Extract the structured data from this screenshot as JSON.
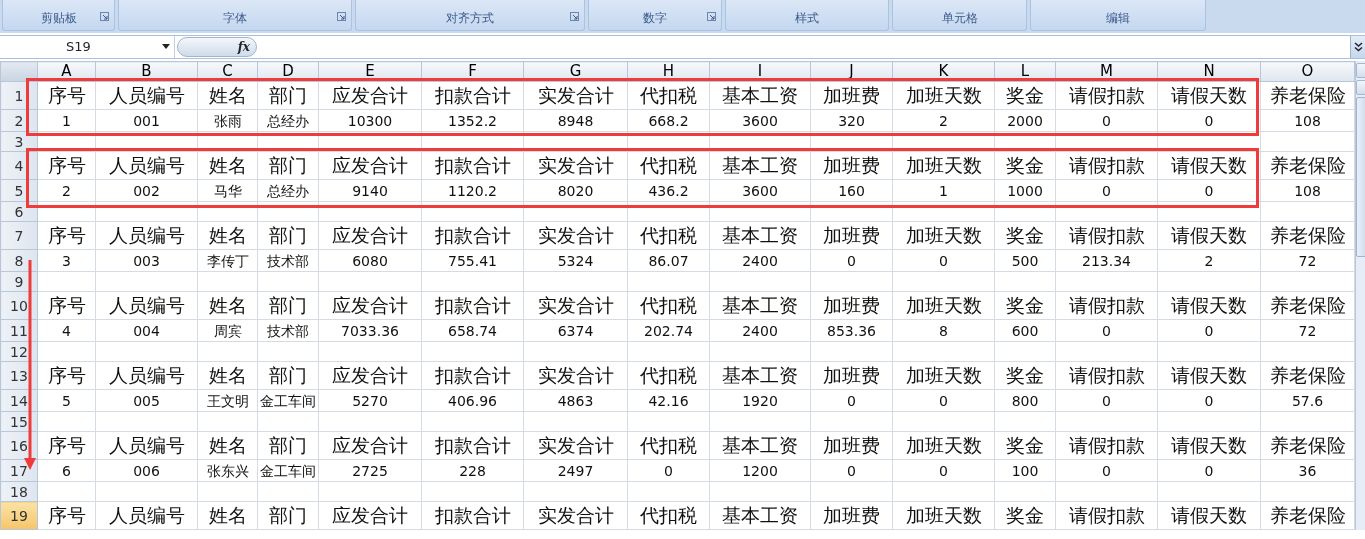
{
  "ribbon": {
    "groups": [
      {
        "label": "剪贴板",
        "has_launcher": true
      },
      {
        "label": "字体",
        "has_launcher": true
      },
      {
        "label": "对齐方式",
        "has_launcher": true
      },
      {
        "label": "数字",
        "has_launcher": true
      },
      {
        "label": "样式",
        "has_launcher": false
      },
      {
        "label": "单元格",
        "has_launcher": false
      },
      {
        "label": "编辑",
        "has_launcher": false
      }
    ]
  },
  "formula_bar": {
    "name_box": "S19",
    "fx": "fx"
  },
  "columns": [
    "A",
    "B",
    "C",
    "D",
    "E",
    "F",
    "G",
    "H",
    "I",
    "J",
    "K",
    "L",
    "M",
    "N",
    "O"
  ],
  "rows": [
    {
      "number": "1",
      "kind": "header",
      "selected": false,
      "cells": [
        "序号",
        "人员编号",
        "姓名",
        "部门",
        "应发合计",
        "扣款合计",
        "实发合计",
        "代扣税",
        "基本工资",
        "加班费",
        "加班天数",
        "奖金",
        "请假扣款",
        "请假天数",
        "养老保险"
      ]
    },
    {
      "number": "2",
      "kind": "data",
      "selected": false,
      "cells": [
        "1",
        "001",
        "张雨",
        "总经办",
        "10300",
        "1352.2",
        "8948",
        "668.2",
        "3600",
        "320",
        "2",
        "2000",
        "0",
        "0",
        "108"
      ]
    },
    {
      "number": "3",
      "kind": "blank",
      "selected": false
    },
    {
      "number": "4",
      "kind": "header",
      "selected": false,
      "cells": [
        "序号",
        "人员编号",
        "姓名",
        "部门",
        "应发合计",
        "扣款合计",
        "实发合计",
        "代扣税",
        "基本工资",
        "加班费",
        "加班天数",
        "奖金",
        "请假扣款",
        "请假天数",
        "养老保险"
      ]
    },
    {
      "number": "5",
      "kind": "data",
      "selected": false,
      "cells": [
        "2",
        "002",
        "马华",
        "总经办",
        "9140",
        "1120.2",
        "8020",
        "436.2",
        "3600",
        "160",
        "1",
        "1000",
        "0",
        "0",
        "108"
      ]
    },
    {
      "number": "6",
      "kind": "blank",
      "selected": false
    },
    {
      "number": "7",
      "kind": "header",
      "selected": false,
      "cells": [
        "序号",
        "人员编号",
        "姓名",
        "部门",
        "应发合计",
        "扣款合计",
        "实发合计",
        "代扣税",
        "基本工资",
        "加班费",
        "加班天数",
        "奖金",
        "请假扣款",
        "请假天数",
        "养老保险"
      ]
    },
    {
      "number": "8",
      "kind": "data",
      "selected": false,
      "cells": [
        "3",
        "003",
        "李传丁",
        "技术部",
        "6080",
        "755.41",
        "5324",
        "86.07",
        "2400",
        "0",
        "0",
        "500",
        "213.34",
        "2",
        "72"
      ]
    },
    {
      "number": "9",
      "kind": "blank",
      "selected": false
    },
    {
      "number": "10",
      "kind": "header",
      "selected": false,
      "cells": [
        "序号",
        "人员编号",
        "姓名",
        "部门",
        "应发合计",
        "扣款合计",
        "实发合计",
        "代扣税",
        "基本工资",
        "加班费",
        "加班天数",
        "奖金",
        "请假扣款",
        "请假天数",
        "养老保险"
      ]
    },
    {
      "number": "11",
      "kind": "data",
      "selected": false,
      "cells": [
        "4",
        "004",
        "周宾",
        "技术部",
        "7033.36",
        "658.74",
        "6374",
        "202.74",
        "2400",
        "853.36",
        "8",
        "600",
        "0",
        "0",
        "72"
      ]
    },
    {
      "number": "12",
      "kind": "blank",
      "selected": false
    },
    {
      "number": "13",
      "kind": "header",
      "selected": false,
      "cells": [
        "序号",
        "人员编号",
        "姓名",
        "部门",
        "应发合计",
        "扣款合计",
        "实发合计",
        "代扣税",
        "基本工资",
        "加班费",
        "加班天数",
        "奖金",
        "请假扣款",
        "请假天数",
        "养老保险"
      ]
    },
    {
      "number": "14",
      "kind": "data",
      "selected": false,
      "cells": [
        "5",
        "005",
        "王文明",
        "金工车间",
        "5270",
        "406.96",
        "4863",
        "42.16",
        "1920",
        "0",
        "0",
        "800",
        "0",
        "0",
        "57.6"
      ]
    },
    {
      "number": "15",
      "kind": "blank",
      "selected": false
    },
    {
      "number": "16",
      "kind": "header",
      "selected": false,
      "cells": [
        "序号",
        "人员编号",
        "姓名",
        "部门",
        "应发合计",
        "扣款合计",
        "实发合计",
        "代扣税",
        "基本工资",
        "加班费",
        "加班天数",
        "奖金",
        "请假扣款",
        "请假天数",
        "养老保险"
      ]
    },
    {
      "number": "17",
      "kind": "data",
      "selected": false,
      "cells": [
        "6",
        "006",
        "张东兴",
        "金工车间",
        "2725",
        "228",
        "2497",
        "0",
        "1200",
        "0",
        "0",
        "100",
        "0",
        "0",
        "36"
      ]
    },
    {
      "number": "18",
      "kind": "blank",
      "selected": false
    },
    {
      "number": "19",
      "kind": "header",
      "selected": true,
      "cells": [
        "序号",
        "人员编号",
        "姓名",
        "部门",
        "应发合计",
        "扣款合计",
        "实发合计",
        "代扣税",
        "基本工资",
        "加班费",
        "加班天数",
        "奖金",
        "请假扣款",
        "请假天数",
        "养老保险"
      ]
    }
  ],
  "annotations": [
    {
      "kind": "box"
    },
    {
      "kind": "box"
    },
    {
      "kind": "arrow"
    }
  ]
}
